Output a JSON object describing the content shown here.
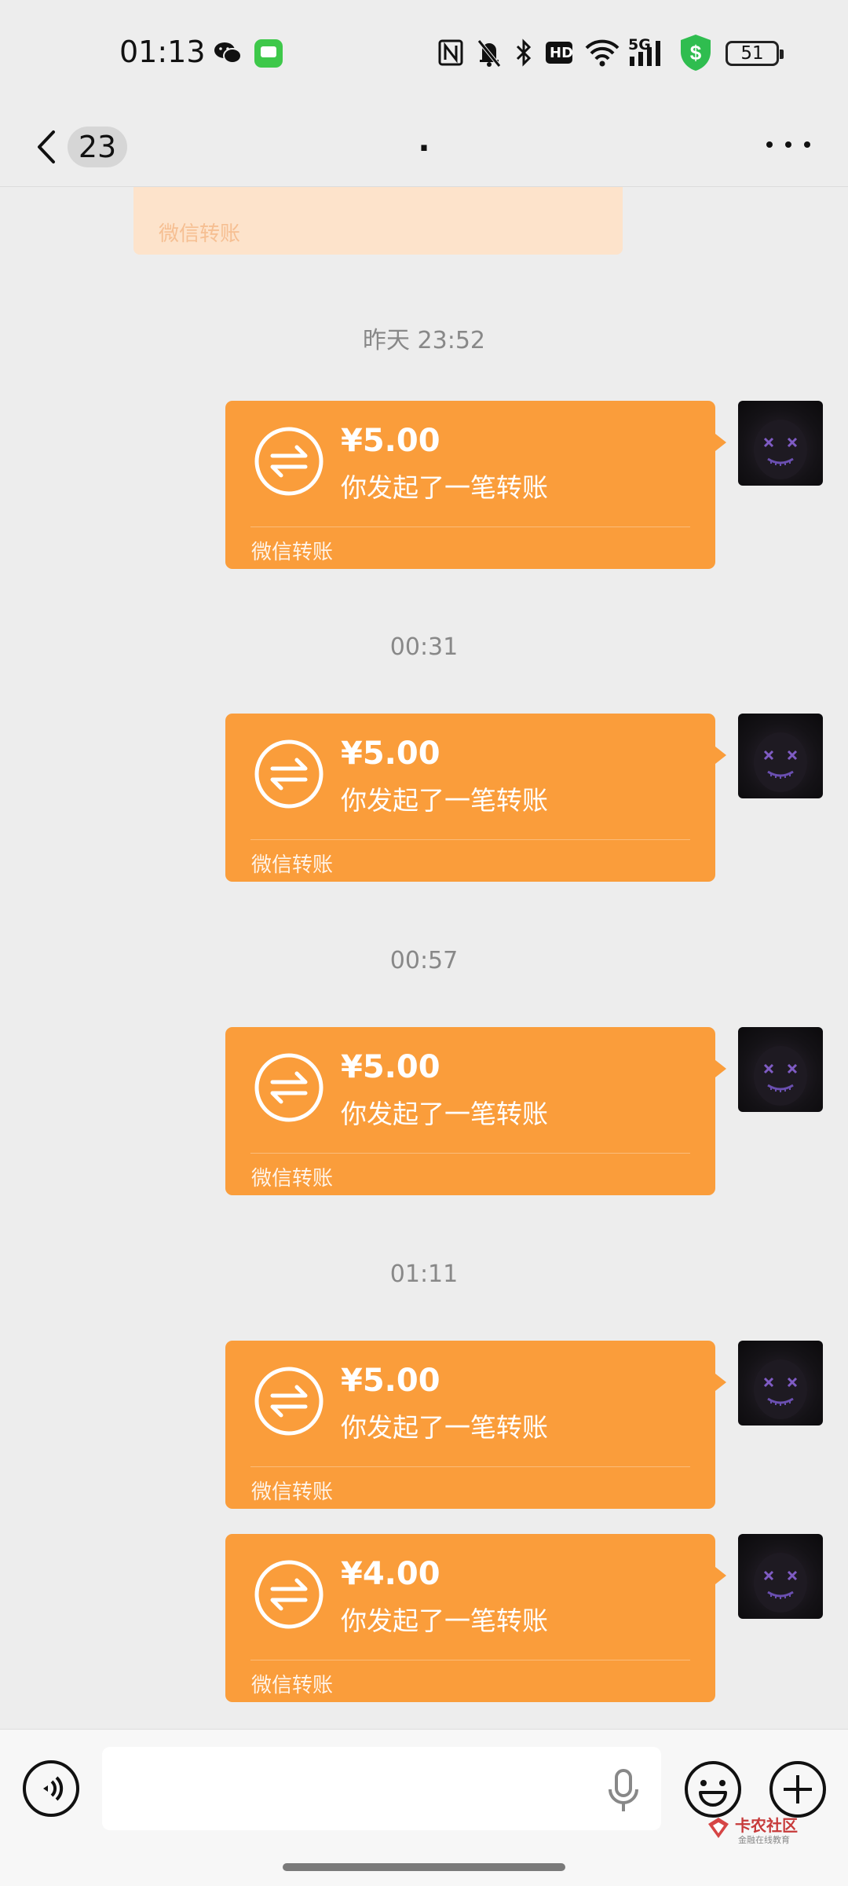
{
  "status_bar": {
    "time": "01:13",
    "signal_label": "5G",
    "hd_label": "HD",
    "battery": "51"
  },
  "nav": {
    "unread_count": "23",
    "title": "."
  },
  "chat": {
    "partial_card_footer": "微信转账",
    "messages": [
      {
        "timestamp": "昨天 23:52",
        "amount": "¥5.00",
        "desc": "你发起了一笔转账",
        "footer": "微信转账"
      },
      {
        "timestamp": "00:31",
        "amount": "¥5.00",
        "desc": "你发起了一笔转账",
        "footer": "微信转账"
      },
      {
        "timestamp": "00:57",
        "amount": "¥5.00",
        "desc": "你发起了一笔转账",
        "footer": "微信转账"
      },
      {
        "timestamp": "01:11",
        "amount": "¥5.00",
        "desc": "你发起了一笔转账",
        "footer": "微信转账"
      },
      {
        "timestamp": "",
        "amount": "¥4.00",
        "desc": "你发起了一笔转账",
        "footer": "微信转账"
      }
    ]
  },
  "input": {
    "placeholder": ""
  },
  "watermark": {
    "title": "卡农社区",
    "subtitle": "金融在线教育"
  },
  "colors": {
    "transfer_card": "#fa9d3b",
    "background": "#ededed",
    "input_bar": "#f7f7f7"
  }
}
